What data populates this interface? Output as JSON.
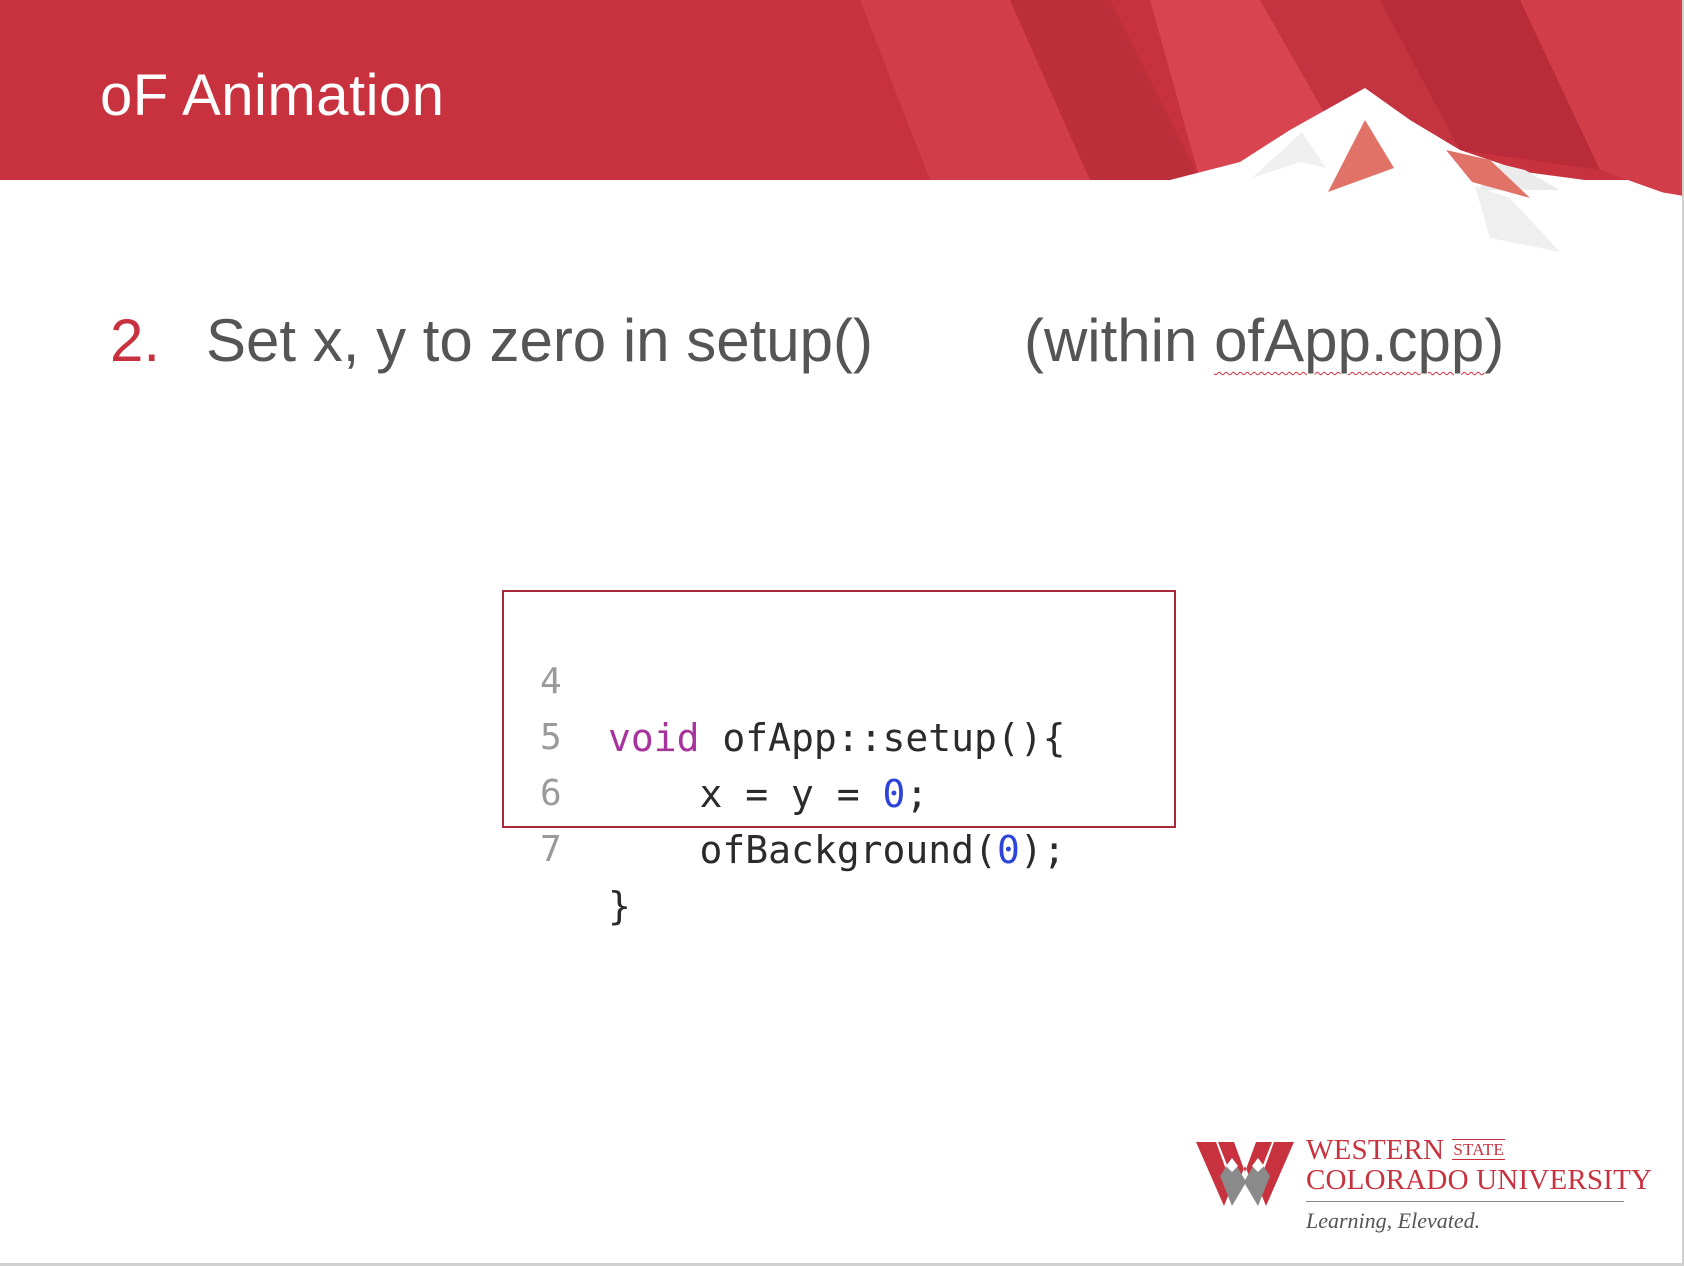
{
  "slide": {
    "title": "oF Animation",
    "step_number": "2.",
    "step_text": "Set x, y to zero in setup()",
    "step_note_prefix": "(within ",
    "step_note_file": "ofApp.cpp",
    "step_note_suffix": ")"
  },
  "code": {
    "lines": [
      {
        "number": "4",
        "parts": [
          {
            "text": "void",
            "kind": "keyword"
          },
          {
            "text": " ofApp::setup(){",
            "kind": "plain"
          }
        ]
      },
      {
        "number": "5",
        "parts": [
          {
            "text": "    x = y = ",
            "kind": "plain"
          },
          {
            "text": "0",
            "kind": "number"
          },
          {
            "text": ";",
            "kind": "plain"
          }
        ]
      },
      {
        "number": "6",
        "parts": [
          {
            "text": "    ofBackground(",
            "kind": "plain"
          },
          {
            "text": "0",
            "kind": "number"
          },
          {
            "text": ");",
            "kind": "plain"
          }
        ]
      },
      {
        "number": "7",
        "parts": [
          {
            "text": "}",
            "kind": "plain"
          }
        ]
      }
    ]
  },
  "logo": {
    "name_line1": "WESTERN",
    "name_state": "STATE",
    "name_line2": "COLORADO UNIVERSITY",
    "tagline": "Learning, Elevated."
  },
  "colors": {
    "header_red": "#c8323f",
    "accent_red": "#c8323f",
    "code_border": "#a9283a",
    "keyword": "#a7349d",
    "number": "#2c44d8",
    "body_text": "#555555"
  },
  "icons": {
    "logo_mark": "western-w-mountain-icon",
    "header_peak": "mountain-peak-icon"
  }
}
